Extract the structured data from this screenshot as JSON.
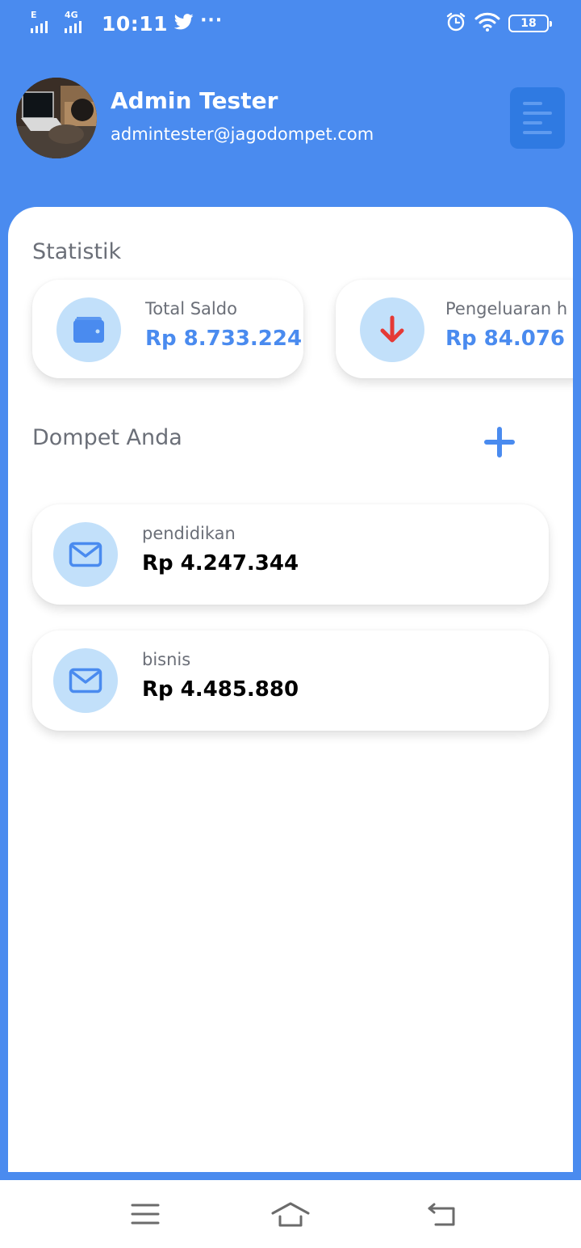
{
  "status_bar": {
    "network_1": "E",
    "network_2": "4G",
    "time": "10:11",
    "more_dots": "···",
    "battery": "18"
  },
  "profile": {
    "name": "Admin Tester",
    "email": "admintester@jagodompet.com"
  },
  "statistics": {
    "title": "Statistik",
    "cards": [
      {
        "label": "Total Saldo",
        "value": "Rp 8.733.224",
        "icon": "wallet-icon"
      },
      {
        "label": "Pengeluaran h",
        "value": "Rp 84.076",
        "icon": "arrow-down-icon"
      }
    ]
  },
  "wallets": {
    "title": "Dompet Anda",
    "items": [
      {
        "name": "pendidikan",
        "balance": "Rp 4.247.344",
        "icon": "envelope-icon"
      },
      {
        "name": "bisnis",
        "balance": "Rp 4.485.880",
        "icon": "envelope-icon"
      }
    ]
  },
  "colors": {
    "primary": "#4a8bef",
    "menu_button": "#2f7ae2",
    "icon_circle": "#c2e0fa",
    "expense_arrow": "#e53935"
  }
}
